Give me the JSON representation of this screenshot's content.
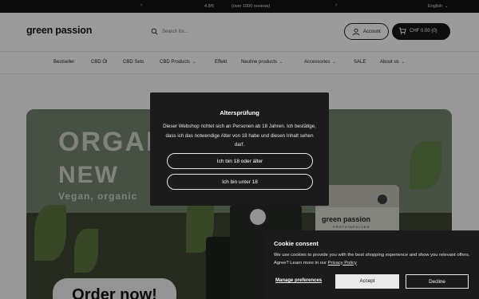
{
  "announcement": {
    "rating": "4.8/5",
    "reviews": "(over 1000 reviews)",
    "prev_arrow": "‹",
    "next_arrow": "›",
    "language": "English",
    "language_chevron": "⌄"
  },
  "header": {
    "logo": "green passion",
    "search_placeholder": "Search for...",
    "account_label": "Account",
    "cart_label": "CHF 0.00 (0)"
  },
  "nav": {
    "items": [
      {
        "label": "Bestseller"
      },
      {
        "label": "CBD Öl"
      },
      {
        "label": "CBD Sets"
      },
      {
        "label": "CBD Products"
      },
      {
        "label": "Effekt"
      },
      {
        "label": "Neuline products"
      },
      {
        "label": "Accessories"
      },
      {
        "label": "SALE"
      },
      {
        "label": "About us"
      }
    ],
    "chevron": "⌄"
  },
  "hero": {
    "headline_line1": "ORGAN      FOOD",
    "headline_line2": "NEW",
    "subline": "Vegan, organic",
    "cta": "Order now!",
    "product_brand": "green passion",
    "product_type": "PROTEINPULVER"
  },
  "age_modal": {
    "title": "Altersprüfung",
    "text": "Dieser Webshop richtet sich an Personen ab 18 Jahren. Ich bestätige, dass ich das notwendige Alter von 18 habe und diesen Inhalt sehen darf.",
    "confirm_label": "Ich bin 18 oder älter",
    "deny_label": "Ich bin unter 18"
  },
  "cookie": {
    "title": "Cookie consent",
    "text": "We use cookies to provide you with the best shopping experience and show you relevant offers. Agree? Learn more in our ",
    "policy_link": "Privacy Policy",
    "manage_label": "Manage preferences",
    "accept_label": "Accept",
    "decline_label": "Decline"
  },
  "colors": {
    "dark": "#151515",
    "page_bg": "#f2f2f2",
    "modal_bg": "#1b1b1b"
  }
}
